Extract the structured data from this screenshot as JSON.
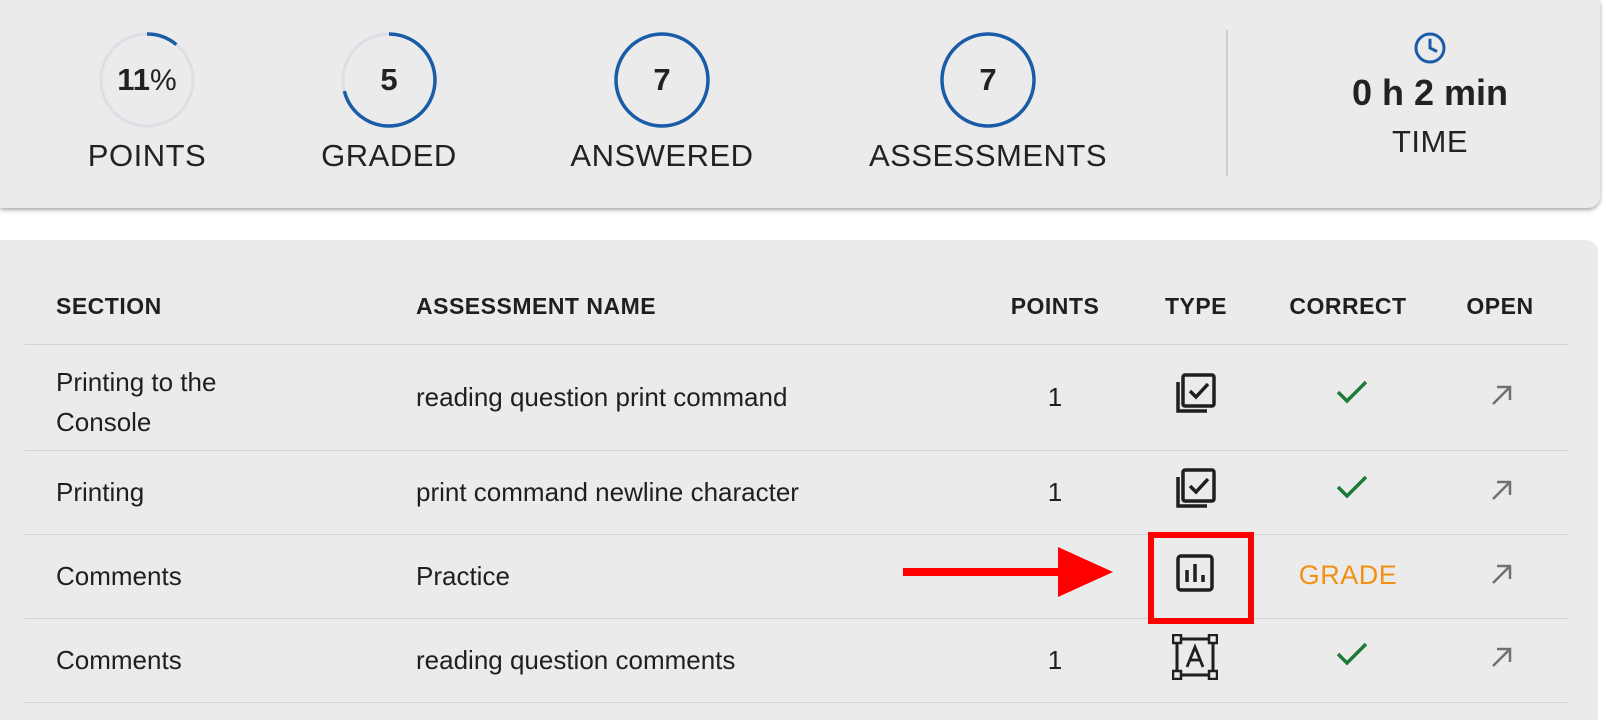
{
  "stats": {
    "points": {
      "value": "11",
      "unit": "%",
      "label": "POINTS",
      "fraction": 0.11
    },
    "graded": {
      "value": "5",
      "label": "GRADED",
      "fraction": 0.71
    },
    "answered": {
      "value": "7",
      "label": "ANSWERED",
      "fraction": 1.0
    },
    "assessments": {
      "value": "7",
      "label": "ASSESSMENTS",
      "fraction": 1.0
    },
    "time": {
      "value": "0 h 2 min",
      "label": "TIME",
      "icon": "clock-icon"
    }
  },
  "table": {
    "headers": {
      "section": "SECTION",
      "name": "ASSESSMENT NAME",
      "points": "POINTS",
      "type": "TYPE",
      "correct": "CORRECT",
      "open": "OPEN"
    },
    "rows": [
      {
        "section_line1": "Printing to the",
        "section_line2": "Console",
        "name": "reading question print command",
        "points": "1",
        "type_icon": "multiple-choice-icon",
        "correct": "check-icon"
      },
      {
        "section_line1": "Printing",
        "section_line2": "",
        "name": "print command newline character",
        "points": "1",
        "type_icon": "multiple-choice-icon",
        "correct": "check-icon"
      },
      {
        "section_line1": "Comments",
        "section_line2": "",
        "name": "Practice",
        "points": "",
        "type_icon": "bar-chart-icon",
        "correct": "GRADE"
      },
      {
        "section_line1": "Comments",
        "section_line2": "",
        "name": "reading question comments",
        "points": "1",
        "type_icon": "text-field-icon",
        "correct": "check-icon"
      }
    ]
  },
  "colors": {
    "accent": "#1a5ca8",
    "ring_track": "#dcdfe5",
    "check": "#1e7a3a",
    "grade": "#f39013",
    "annotation": "#ff0000"
  }
}
